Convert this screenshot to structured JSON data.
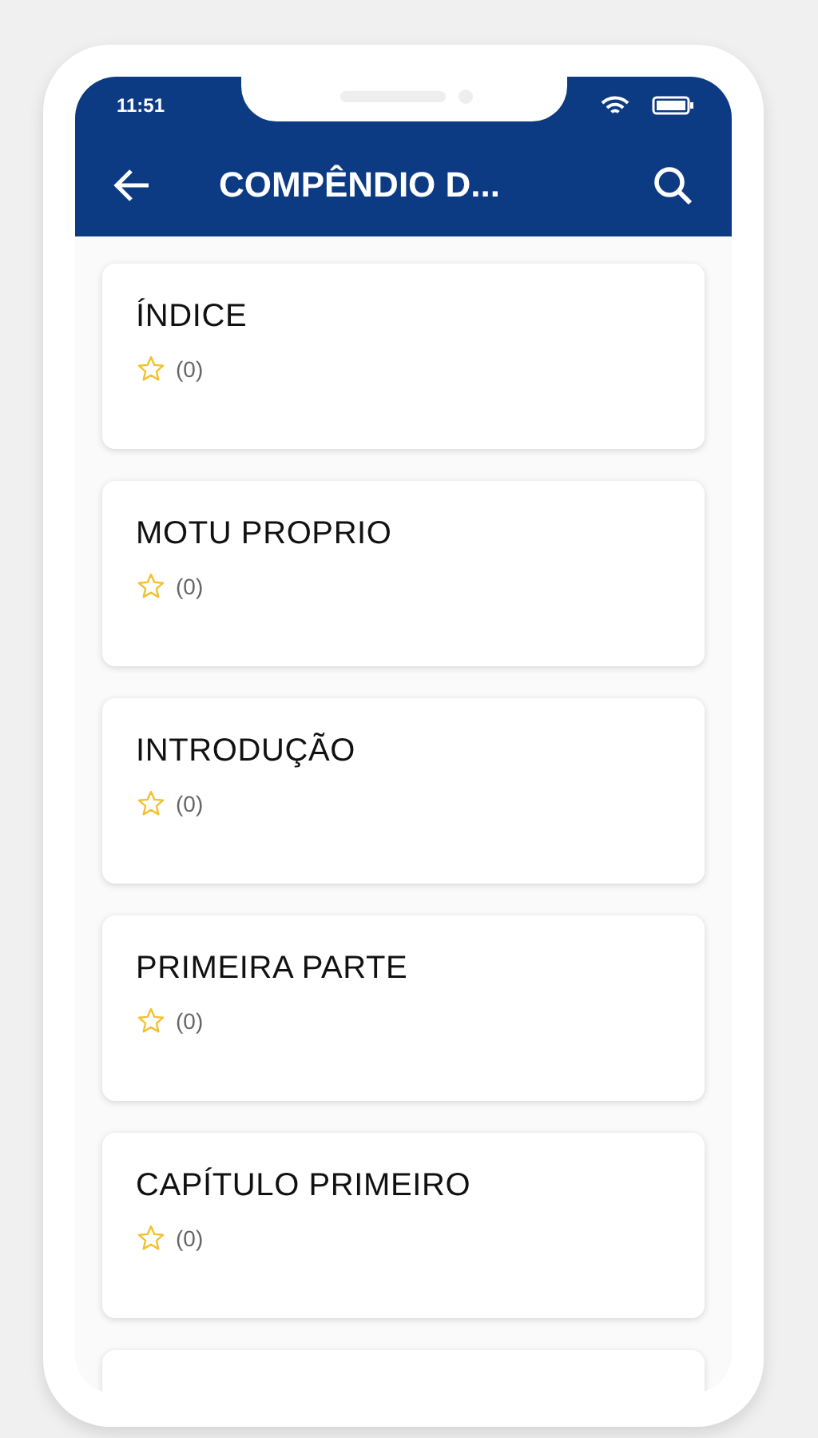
{
  "status_bar": {
    "time": "11:51"
  },
  "header": {
    "title": "COMPÊNDIO D..."
  },
  "items": [
    {
      "title": "ÍNDICE",
      "favorite": false,
      "count": "(0)"
    },
    {
      "title": "MOTU PROPRIO",
      "favorite": false,
      "count": "(0)"
    },
    {
      "title": "INTRODUÇÃO",
      "favorite": false,
      "count": "(0)"
    },
    {
      "title": "PRIMEIRA PARTE",
      "favorite": false,
      "count": "(0)"
    },
    {
      "title": "CAPÍTULO PRIMEIRO",
      "favorite": false,
      "count": "(0)"
    }
  ]
}
